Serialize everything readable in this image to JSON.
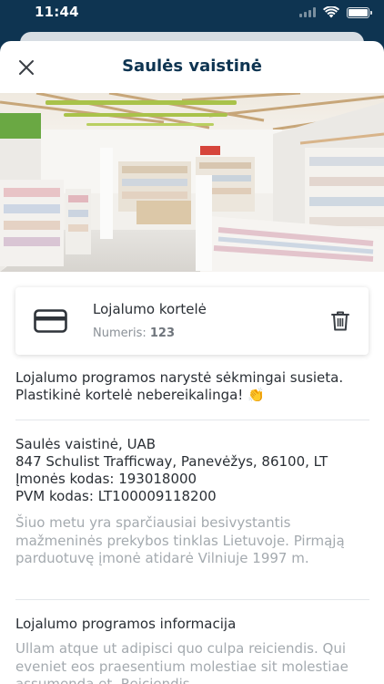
{
  "status_bar": {
    "time": "11:44"
  },
  "header": {
    "title": "Saulės vaistinė",
    "close_icon": "close-icon"
  },
  "card": {
    "title": "Lojalumo kortelė",
    "number_label": "Numeris:",
    "number_value": "123",
    "icon": "credit-card-icon",
    "delete_icon": "trash-icon"
  },
  "success_message": "Lojalumo programos narystė sėkmingai susieta. Plastikinė kortelė nebereikalinga! 👏",
  "company": {
    "name": "Saulės vaistinė, UAB",
    "address": "847 Schulist Trafficway, Panevėžys, 86100, LT",
    "company_code": "Įmonės kodas: 193018000",
    "vat_code": "PVM kodas: LT100009118200",
    "description": "Šiuo metu yra sparčiausiai besivystantis mažmeninės prekybos tinklas Lietuvoje. Pirmąją parduotuvę įmonė atidarė Vilniuje 1997 m."
  },
  "loyalty_info": {
    "heading": "Lojalumo programos informacija",
    "text": "Ullam atque ut adipisci quo culpa reiciendis. Qui eveniet eos praesentium molestiae sit molestiae assumenda et. Reiciendis"
  }
}
